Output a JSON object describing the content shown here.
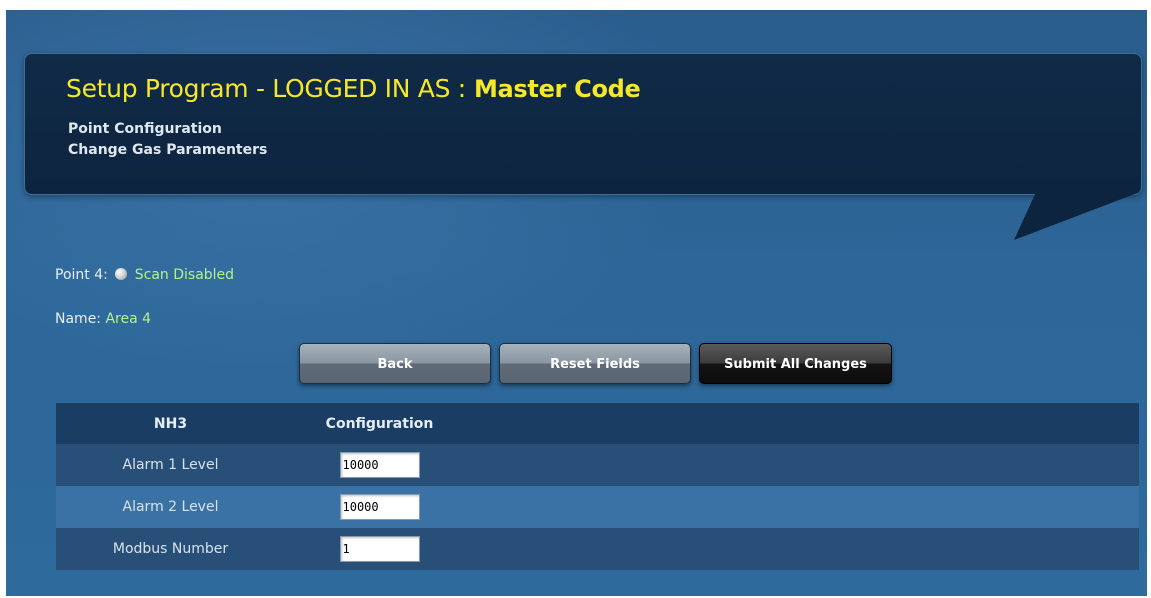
{
  "header": {
    "title": "Setup Program - LOGGED IN AS :",
    "role": "Master Code",
    "breadcrumb_1": "Point Configuration",
    "breadcrumb_2": "Change Gas Paramenters"
  },
  "point": {
    "label": "Point 4:",
    "status": "Scan Disabled",
    "name_label": "Name:",
    "name_value": "Area 4"
  },
  "buttons": {
    "back": "Back",
    "reset": "Reset Fields",
    "submit": "Submit All Changes"
  },
  "table": {
    "headers": [
      "NH3",
      "Configuration"
    ],
    "rows": [
      {
        "label": "Alarm 1 Level",
        "value": "10000"
      },
      {
        "label": "Alarm 2 Level",
        "value": "10000"
      },
      {
        "label": "Modbus Number",
        "value": "1"
      }
    ]
  },
  "colors": {
    "title": "#f5e82a",
    "value_text": "#b6f28c",
    "background": "#2d6698",
    "banner": "#0d243f"
  }
}
